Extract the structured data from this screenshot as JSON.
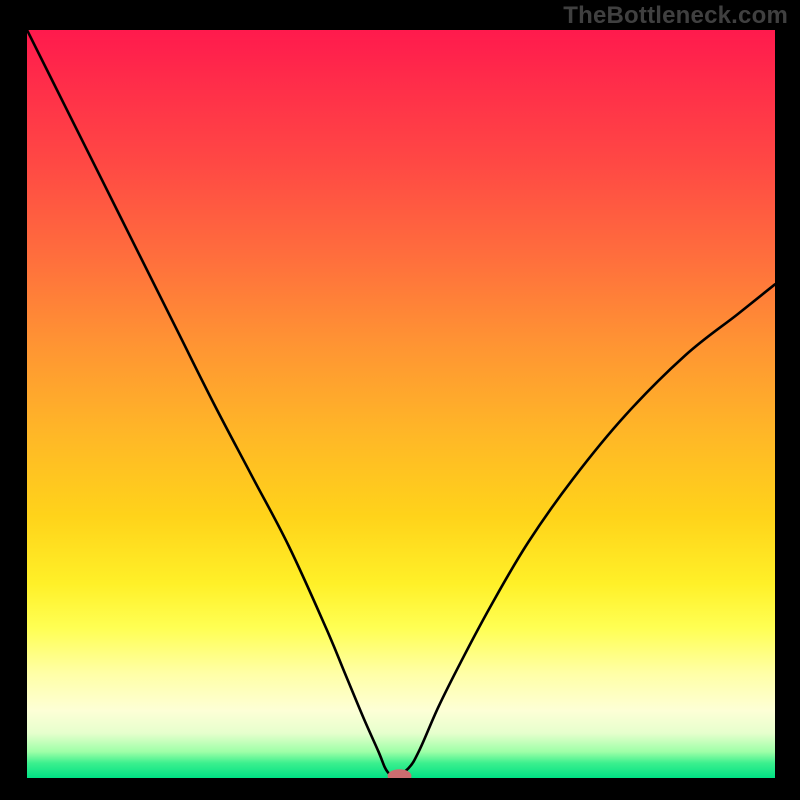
{
  "watermark": "TheBottleneck.com",
  "chart_data": {
    "type": "line",
    "title": "",
    "xlabel": "",
    "ylabel": "",
    "xlim": [
      0,
      100
    ],
    "ylim": [
      0,
      100
    ],
    "grid": false,
    "legend": false,
    "annotations": [],
    "series": [
      {
        "name": "bottleneck-curve",
        "color": "#000000",
        "x": [
          0,
          5,
          10,
          15,
          20,
          25,
          30,
          35,
          40,
          42.5,
          45,
          47,
          47.8,
          48.3,
          48.7,
          49,
          51,
          52.5,
          55,
          58,
          62,
          67,
          73,
          80,
          88,
          95,
          100
        ],
        "values": [
          100,
          90,
          80,
          70,
          60,
          50,
          40.5,
          31,
          20,
          14,
          8,
          3.5,
          1.5,
          0.7,
          0.3,
          0,
          1.3,
          3.8,
          9.5,
          15.5,
          23,
          31.5,
          40,
          48.5,
          56.5,
          62,
          66
        ]
      }
    ],
    "marker": {
      "name": "optimal-point",
      "x": 49.8,
      "y": 0,
      "rx": 1.6,
      "ry": 0.9,
      "color": "#cc6d70"
    },
    "background_gradient_stops": [
      {
        "pos": 0,
        "color": "#ff1a4d"
      },
      {
        "pos": 0.18,
        "color": "#ff4944"
      },
      {
        "pos": 0.42,
        "color": "#ff9433"
      },
      {
        "pos": 0.65,
        "color": "#ffd31a"
      },
      {
        "pos": 0.8,
        "color": "#ffff54"
      },
      {
        "pos": 0.91,
        "color": "#fdffd6"
      },
      {
        "pos": 0.97,
        "color": "#9effa7"
      },
      {
        "pos": 1.0,
        "color": "#00e184"
      }
    ]
  }
}
